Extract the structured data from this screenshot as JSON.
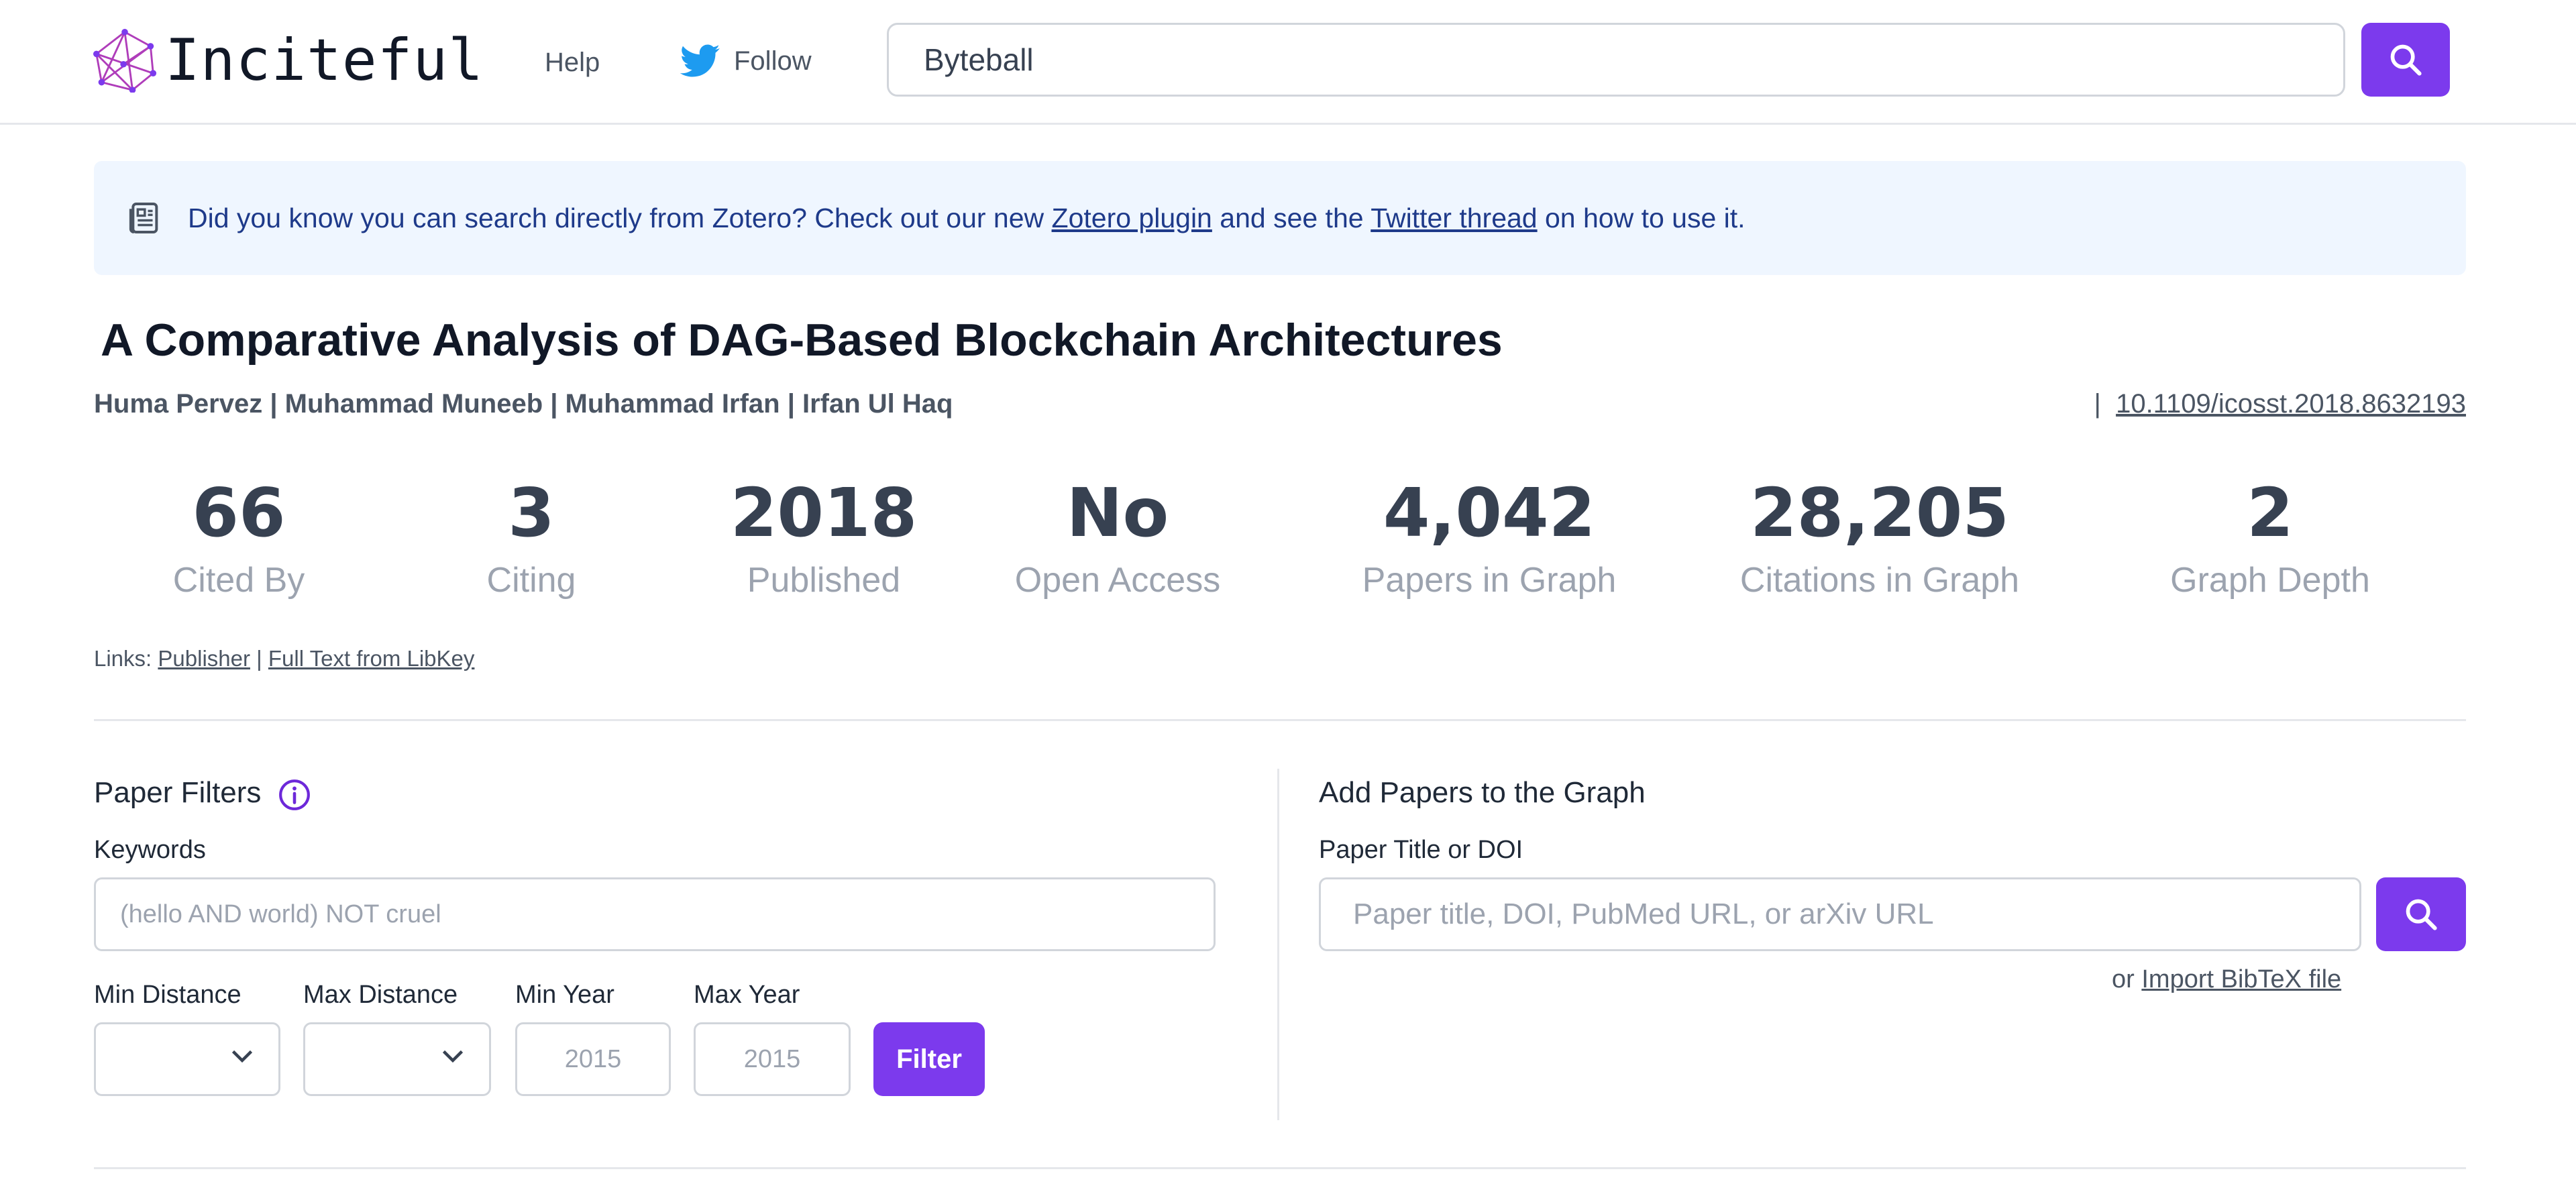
{
  "header": {
    "logo_text": "Inciteful",
    "nav_help": "Help",
    "nav_follow": "Follow",
    "search_value": "Byteball"
  },
  "banner": {
    "text_1": "Did you know you can search directly from Zotero? Check out our new ",
    "link_zotero": "Zotero plugin",
    "text_2": " and see the ",
    "link_twitter": "Twitter thread",
    "text_3": " on how to use it."
  },
  "paper": {
    "title": "A Comparative Analysis of DAG-Based Blockchain Architectures",
    "authors": "Huma Pervez | Muhammad Muneeb | Muhammad Irfan | Irfan Ul Haq",
    "doi_separator": "|",
    "doi": "10.1109/icosst.2018.8632193"
  },
  "stats": [
    {
      "value": "66",
      "label": "Cited By"
    },
    {
      "value": "3",
      "label": "Citing"
    },
    {
      "value": "2018",
      "label": "Published"
    },
    {
      "value": "No",
      "label": "Open Access"
    },
    {
      "value": "4,042",
      "label": "Papers in Graph"
    },
    {
      "value": "28,205",
      "label": "Citations in Graph"
    },
    {
      "value": "2",
      "label": "Graph Depth"
    }
  ],
  "links": {
    "prefix": "Links:",
    "publisher": "Publisher",
    "separator": "|",
    "libkey": "Full Text from LibKey"
  },
  "filters": {
    "title": "Paper Filters",
    "keywords_label": "Keywords",
    "keywords_placeholder": "(hello AND world) NOT cruel",
    "min_distance_label": "Min Distance",
    "max_distance_label": "Max Distance",
    "min_year_label": "Min Year",
    "max_year_label": "Max Year",
    "min_year_placeholder": "2015",
    "max_year_placeholder": "2015",
    "filter_button": "Filter"
  },
  "add_papers": {
    "title": "Add Papers to the Graph",
    "field_label": "Paper Title or DOI",
    "placeholder": "Paper title, DOI, PubMed URL, or arXiv URL",
    "import_prefix": "or",
    "import_link": "Import BibTeX file"
  },
  "colors": {
    "accent": "#7c3aed",
    "banner_bg": "#eff6ff",
    "banner_text": "#1e3a8a",
    "twitter": "#1d9bf0"
  }
}
